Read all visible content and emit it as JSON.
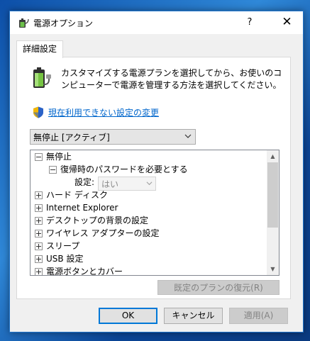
{
  "window": {
    "title": "電源オプション",
    "help_glyph": "?",
    "close_glyph": "✕"
  },
  "tab": {
    "label": "詳細設定"
  },
  "description": "カスタマイズする電源プランを選択してから、お使いのコンピューターで電源を管理する方法を選択してください。",
  "link": {
    "label": "現在利用できない設定の変更"
  },
  "plan_select": {
    "value": "無停止 [アクティブ]"
  },
  "tree": {
    "items": [
      {
        "label": "無停止",
        "state": "expanded"
      },
      {
        "label": "復帰時のパスワードを必要とする",
        "state": "expanded"
      },
      {
        "label": "設定:",
        "value": "はい"
      },
      {
        "label": "ハード ディスク",
        "state": "collapsed"
      },
      {
        "label": "Internet Explorer",
        "state": "collapsed"
      },
      {
        "label": "デスクトップの背景の設定",
        "state": "collapsed"
      },
      {
        "label": "ワイヤレス アダプターの設定",
        "state": "collapsed"
      },
      {
        "label": "スリープ",
        "state": "collapsed"
      },
      {
        "label": "USB 設定",
        "state": "collapsed"
      },
      {
        "label": "電源ボタンとカバー",
        "state": "collapsed"
      }
    ]
  },
  "buttons": {
    "restore": "既定のプランの復元(R)",
    "ok": "OK",
    "cancel": "キャンセル",
    "apply": "適用(A)"
  },
  "colors": {
    "link": "#0066cc",
    "focus_border": "#0078d7",
    "window_border": "#1f73c9"
  },
  "icons": [
    "power-options-icon",
    "battery-plug-icon",
    "uac-shield-icon",
    "chevron-down-icon",
    "scroll-up-arrow-icon",
    "scroll-down-arrow-icon"
  ]
}
